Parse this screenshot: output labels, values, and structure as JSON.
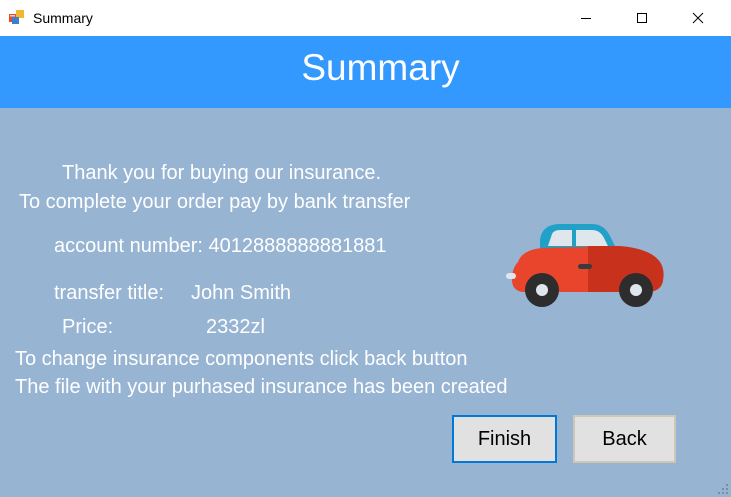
{
  "window": {
    "title": "Summary"
  },
  "header": {
    "title": "Summary"
  },
  "body": {
    "thanks_line": "Thank you for buying our insurance.",
    "complete_line": "To complete your order pay by bank transfer",
    "account_line": "account number: 4012888888881881",
    "transfer_label": "transfer title:",
    "transfer_value": "John Smith",
    "price_label": "Price:",
    "price_value": "2332zl",
    "change_line": "To change insurance components click back button",
    "file_line": "The file with your purhased insurance has been created"
  },
  "buttons": {
    "finish": "Finish",
    "back": "Back"
  },
  "icons": {
    "app": "app-icon",
    "car": "car-icon"
  },
  "colors": {
    "header_bg": "#3399ff",
    "content_bg": "#97b4d3",
    "text": "#ffffff",
    "finish_border": "#0078d7",
    "car_body": "#e8452c"
  }
}
